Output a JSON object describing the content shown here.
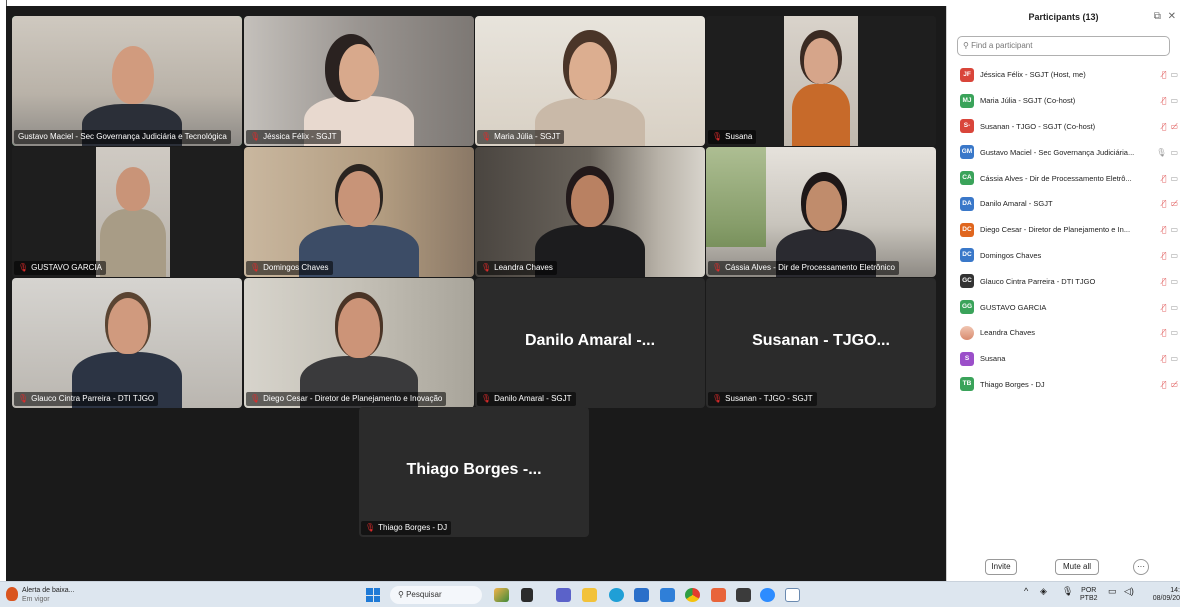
{
  "gallery": {
    "tiles": [
      {
        "name": "Gustavo Maciel - Sec Governança Judiciária e Tecnológica",
        "muted": false
      },
      {
        "name": "Jéssica Félix - SGJT",
        "muted": true
      },
      {
        "name": "Maria Júlia - SGJT",
        "muted": true
      },
      {
        "name": "Susana",
        "muted": true
      },
      {
        "name": "GUSTAVO GARCIA",
        "muted": true
      },
      {
        "name": "Domingos Chaves",
        "muted": true
      },
      {
        "name": "Leandra Chaves",
        "muted": true
      },
      {
        "name": "Cássia Alves - Dir de Processamento Eletrônico",
        "muted": true
      },
      {
        "name": "Glauco Cintra Parreira - DTI TJGO",
        "muted": true
      },
      {
        "name": "Diego Cesar - Diretor de Planejamento e Inovação",
        "muted": true
      },
      {
        "name": "Danilo Amaral - SGJT",
        "display": "Danilo Amaral -...",
        "muted": true
      },
      {
        "name": "Susanan - TJGO - SGJT",
        "display": "Susanan - TJGO...",
        "muted": true
      },
      {
        "name": "Thiago Borges - DJ",
        "display": "Thiago Borges -...",
        "muted": true
      }
    ]
  },
  "panel": {
    "title": "Participants (13)",
    "search_placeholder": "Find a participant",
    "participants": [
      {
        "initials": "JF",
        "name": "Jéssica Félix - SGJT (Host, me)",
        "color": "#d9453a"
      },
      {
        "initials": "MJ",
        "name": "Maria Júlia - SGJT (Co-host)",
        "color": "#3aa35a"
      },
      {
        "initials": "S-",
        "name": "Susanan - TJGO - SGJT (Co-host)",
        "color": "#d9453a"
      },
      {
        "initials": "GM",
        "name": "Gustavo Maciel - Sec Governança Judiciária...",
        "color": "#3a78c9"
      },
      {
        "initials": "CA",
        "name": "Cássia Alves - Dir de Processamento Eletrô...",
        "color": "#3aa35a"
      },
      {
        "initials": "DA",
        "name": "Danilo Amaral - SGJT",
        "color": "#3a78c9"
      },
      {
        "initials": "DC",
        "name": "Diego Cesar - Diretor de Planejamento e In...",
        "color": "#e0661e"
      },
      {
        "initials": "DC",
        "name": "Domingos Chaves",
        "color": "#3a78c9"
      },
      {
        "initials": "GC",
        "name": "Glauco Cintra Parreira - DTI TJGO",
        "color": "#333333"
      },
      {
        "initials": "GG",
        "name": "GUSTAVO GARCIA",
        "color": "#3aa35a"
      },
      {
        "initials": "",
        "name": "Leandra Chaves",
        "color": "#e8a38c"
      },
      {
        "initials": "S",
        "name": "Susana",
        "color": "#9b4fc9"
      },
      {
        "initials": "TB",
        "name": "Thiago Borges - DJ",
        "color": "#3aa35a"
      }
    ],
    "invite_label": "Invite",
    "mute_all_label": "Mute all",
    "more_label": "···"
  },
  "taskbar": {
    "alert_title": "Alerta de baixa...",
    "alert_sub": "Em vigor",
    "search_label": "Pesquisar",
    "lang_top": "POR",
    "lang_bottom": "PTB2",
    "time": "14:",
    "date": "08/09/20"
  },
  "colors": {
    "active_speaker": "#2ecc71",
    "muted_icon": "#e02b2b",
    "gallery_bg": "#1a1a1a"
  }
}
